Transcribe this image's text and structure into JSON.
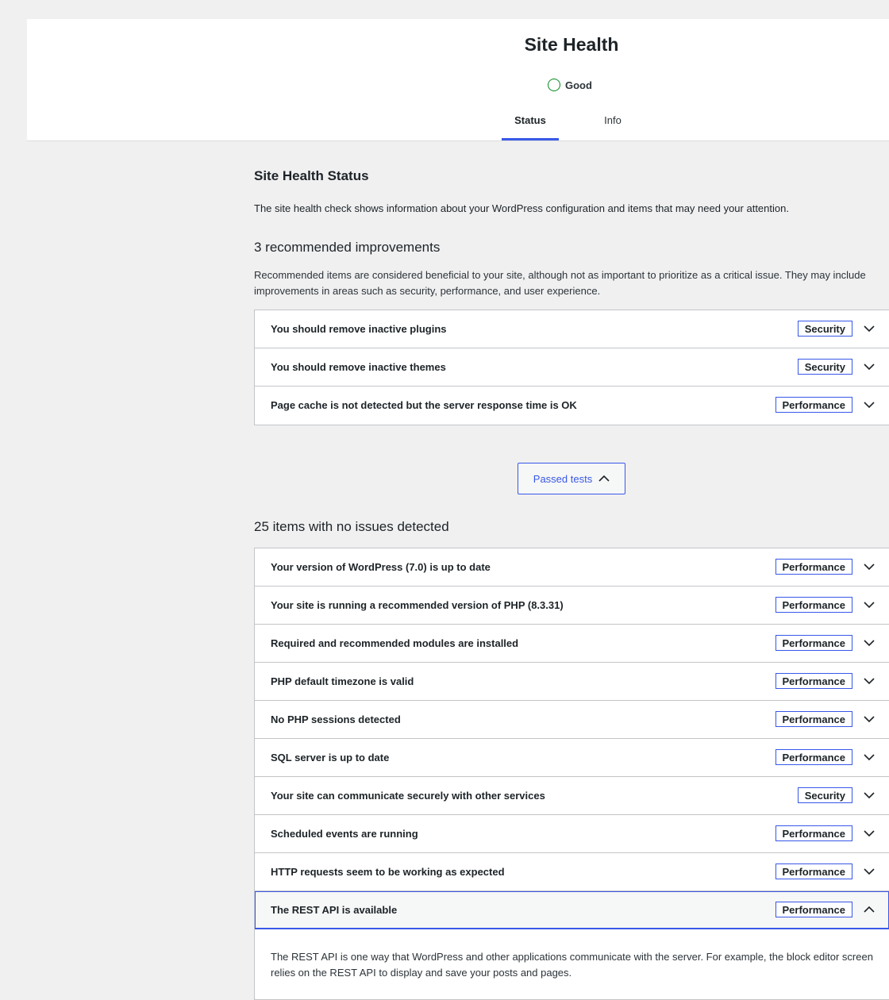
{
  "header": {
    "title": "Site Health",
    "score_label": "Good",
    "tabs": [
      {
        "label": "Status",
        "active": true
      },
      {
        "label": "Info",
        "active": false
      }
    ]
  },
  "status": {
    "title": "Site Health Status",
    "intro": "The site health check shows information about your WordPress configuration and items that may need your attention."
  },
  "recommended": {
    "heading": "3 recommended improvements",
    "description": "Recommended items are considered beneficial to your site, although not as important to prioritize as a critical issue. They may include improvements in areas such as security, performance, and user experience.",
    "items": [
      {
        "title": "You should remove inactive plugins",
        "badge": "Security"
      },
      {
        "title": "You should remove inactive themes",
        "badge": "Security"
      },
      {
        "title": "Page cache is not detected but the server response time is OK",
        "badge": "Performance"
      }
    ]
  },
  "passed_button": {
    "label": "Passed tests"
  },
  "passed": {
    "heading": "25 items with no issues detected",
    "items": [
      {
        "title": "Your version of WordPress (7.0) is up to date",
        "badge": "Performance"
      },
      {
        "title": "Your site is running a recommended version of PHP (8.3.31)",
        "badge": "Performance"
      },
      {
        "title": "Required and recommended modules are installed",
        "badge": "Performance"
      },
      {
        "title": "PHP default timezone is valid",
        "badge": "Performance"
      },
      {
        "title": "No PHP sessions detected",
        "badge": "Performance"
      },
      {
        "title": "SQL server is up to date",
        "badge": "Performance"
      },
      {
        "title": "Your site can communicate securely with other services",
        "badge": "Security"
      },
      {
        "title": "Scheduled events are running",
        "badge": "Performance"
      },
      {
        "title": "HTTP requests seem to be working as expected",
        "badge": "Performance"
      },
      {
        "title": "The REST API is available",
        "badge": "Performance"
      }
    ],
    "expanded_text": "The REST API is one way that WordPress and other applications communicate with the server. For example, the block editor screen relies on the REST API to display and save your posts and pages."
  },
  "colors": {
    "accent": "#3858e9",
    "good": "#008a20",
    "background": "#f0f0f1"
  }
}
